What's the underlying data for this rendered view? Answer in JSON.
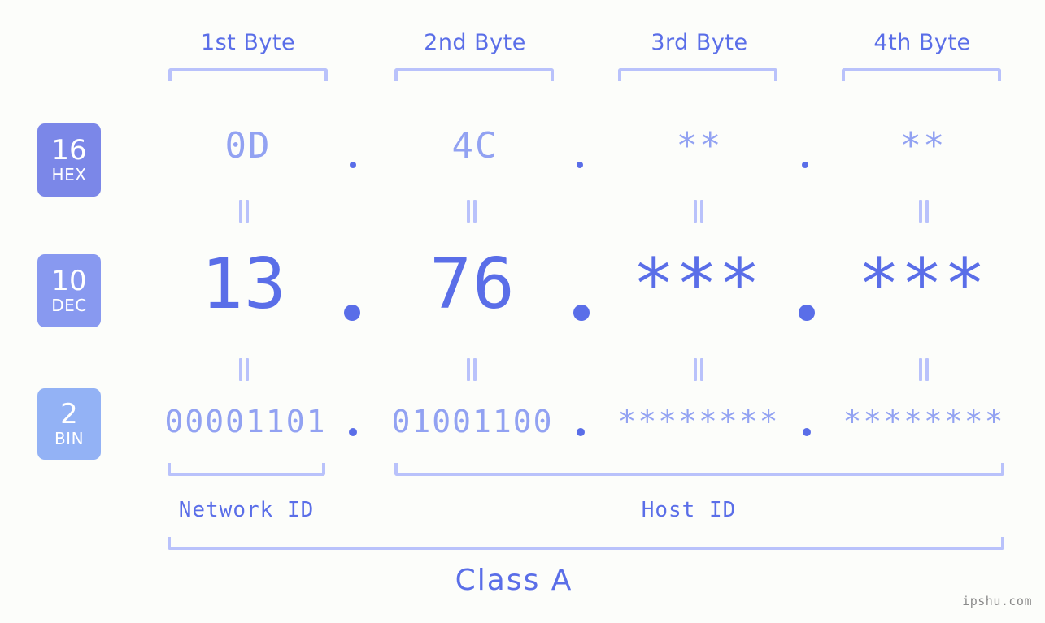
{
  "headers": [
    {
      "label": "1st Byte"
    },
    {
      "label": "2nd Byte"
    },
    {
      "label": "3rd Byte"
    },
    {
      "label": "4th Byte"
    }
  ],
  "bases": [
    {
      "num": "16",
      "name": "HEX",
      "color": "#7b87e8"
    },
    {
      "num": "10",
      "name": "DEC",
      "color": "#8899f0"
    },
    {
      "num": "2",
      "name": "BIN",
      "color": "#93b2f5"
    }
  ],
  "rows": {
    "hex": {
      "values": [
        "0D",
        "4C",
        "**",
        "**"
      ]
    },
    "dec": {
      "values": [
        "13",
        "76",
        "***",
        "***"
      ]
    },
    "bin": {
      "values": [
        "00001101",
        "01001100",
        "********",
        "********"
      ]
    }
  },
  "separator": ".",
  "equals": "||",
  "segments": {
    "network_id": "Network ID",
    "host_id": "Host ID"
  },
  "class": {
    "label": "Class A"
  },
  "watermark": {
    "text": "ipshu.com"
  },
  "colors": {
    "background": "#fcfdfa",
    "accent_strong": "#5a6ee8",
    "accent_light": "#92a2f2",
    "bracket": "#b9c2fb",
    "watermark": "#8a8a8a"
  }
}
